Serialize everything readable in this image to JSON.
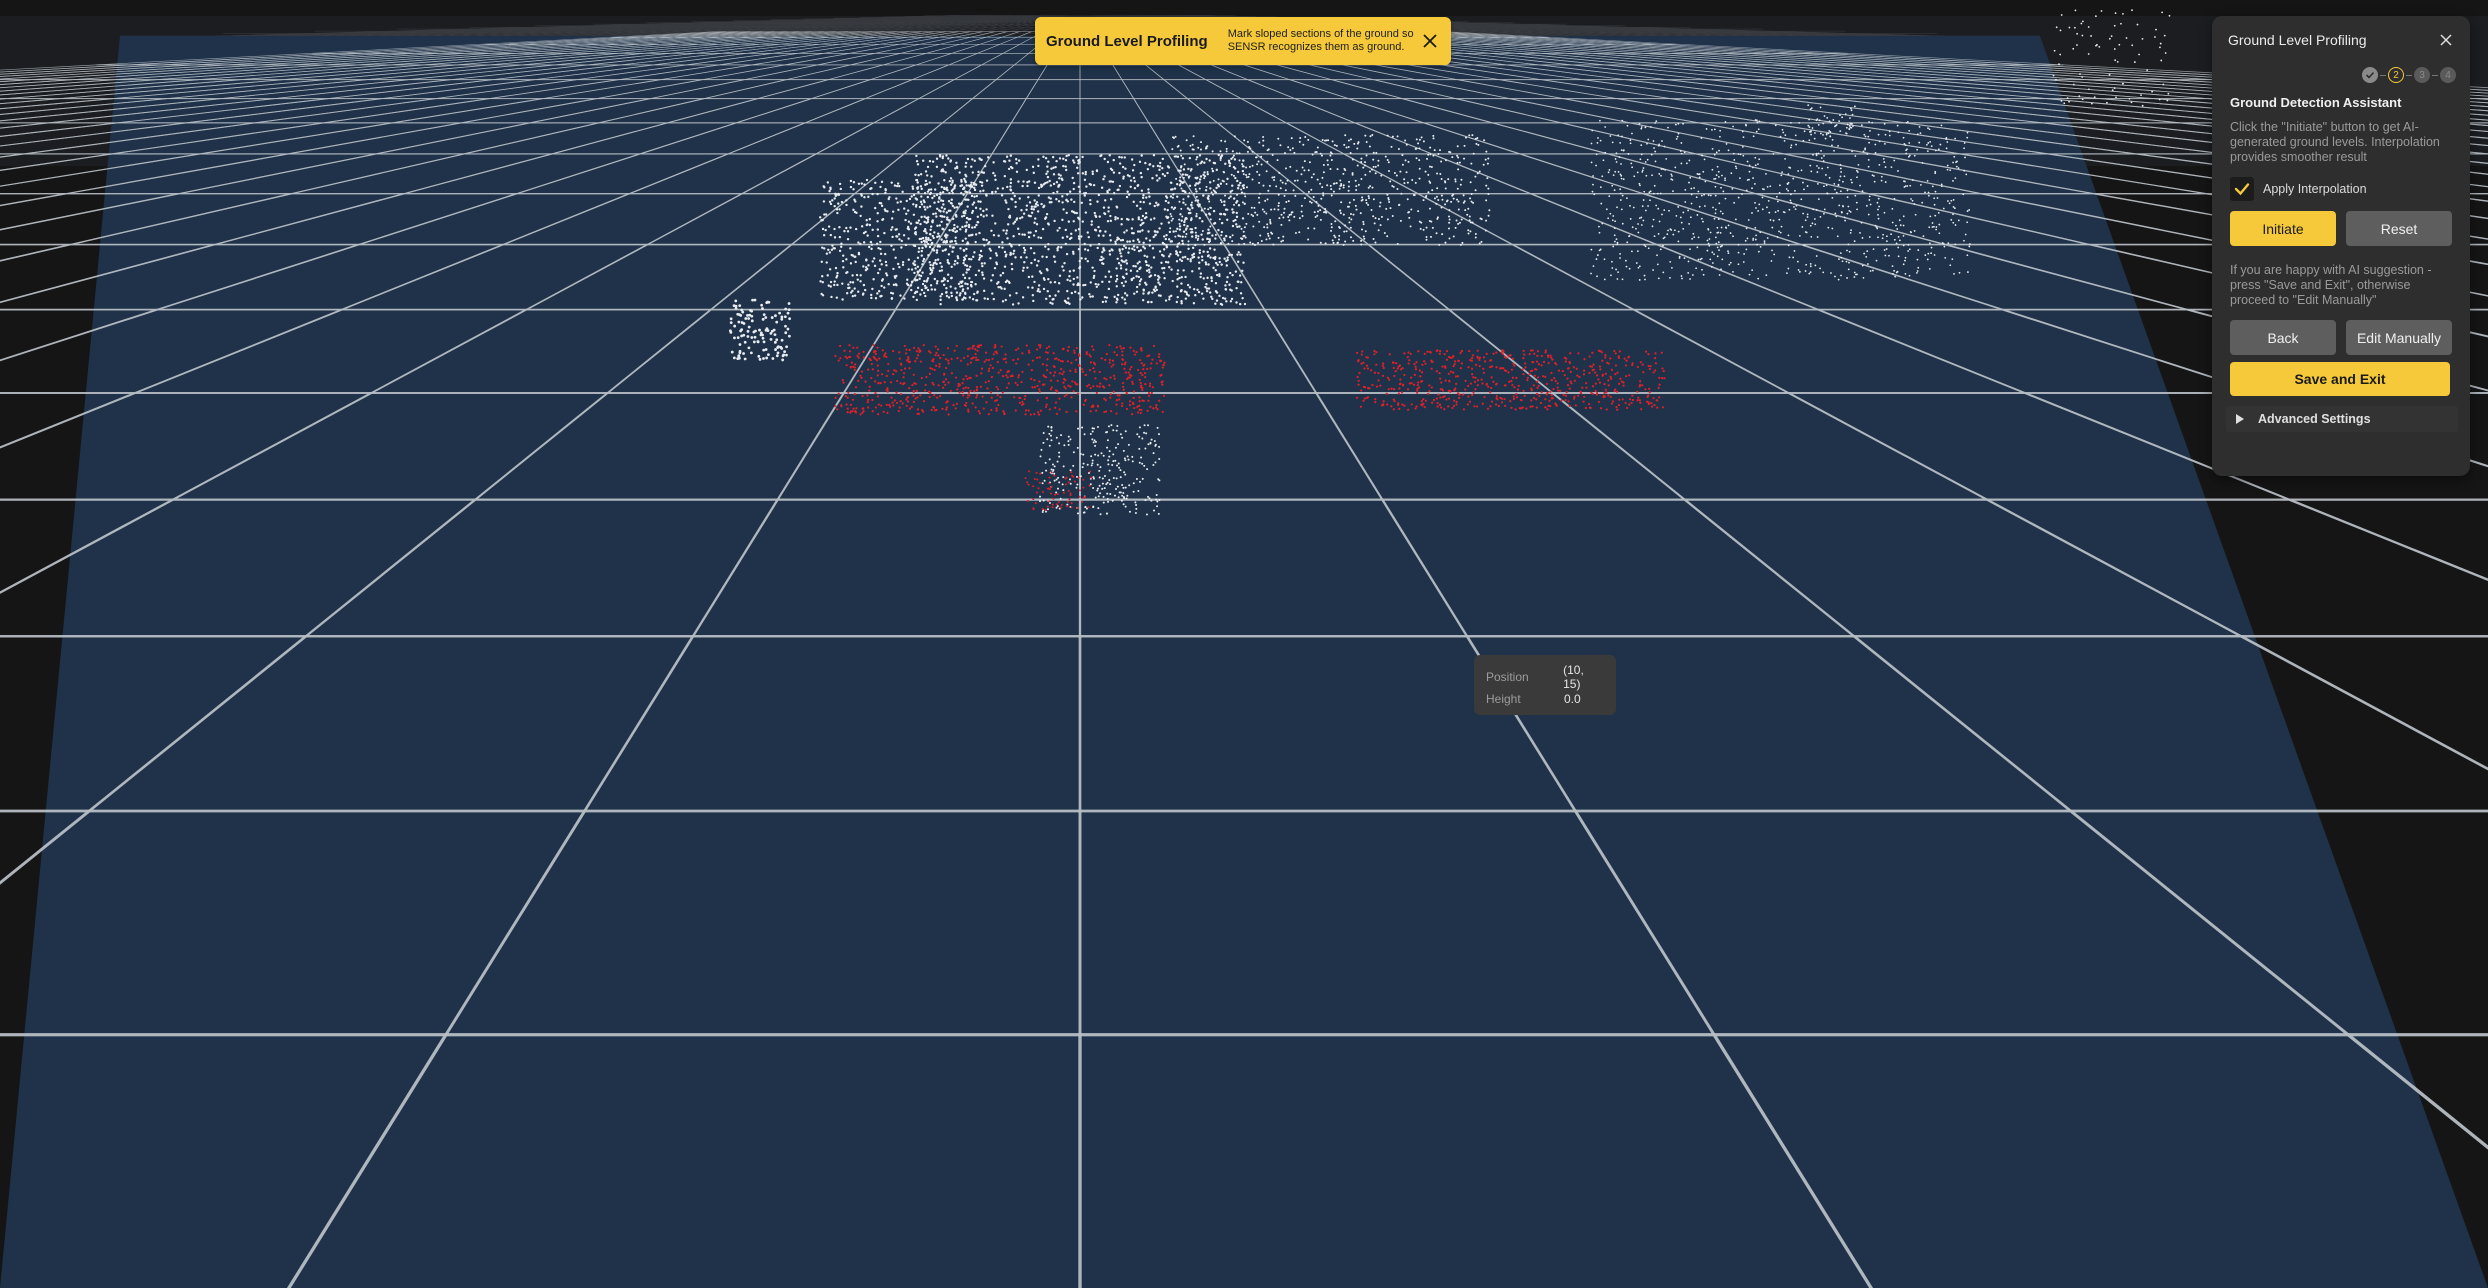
{
  "toast": {
    "title": "Ground Level Profiling",
    "message": "Mark sloped sections of the ground so SENSR recognizes them as ground."
  },
  "panel": {
    "title": "Ground Level Profiling",
    "steps": [
      {
        "label": "",
        "state": "done"
      },
      {
        "label": "2",
        "state": "active"
      },
      {
        "label": "3",
        "state": "todo"
      },
      {
        "label": "4",
        "state": "todo"
      }
    ],
    "section_title": "Ground Detection Assistant",
    "description": "Click the \"Initiate\" button to get AI-generated ground levels. Interpolation provides smoother result",
    "checkbox_label": "Apply Interpolation",
    "checkbox_checked": true,
    "initiate_label": "Initiate",
    "reset_label": "Reset",
    "description2": "If you are happy with AI suggestion - press \"Save and Exit\", otherwise proceed to \"Edit Manually\"",
    "back_label": "Back",
    "edit_manually_label": "Edit Manually",
    "save_exit_label": "Save and Exit",
    "advanced_label": "Advanced Settings"
  },
  "tooltip": {
    "position_label": "Position",
    "position_value": "(10, 15)",
    "height_label": "Height",
    "height_value": "0.0"
  },
  "colors": {
    "accent": "#f5c93a",
    "ground_plane": "#1f3249",
    "grid_line": "#b8bfc6",
    "highlight_points": "#e0202a",
    "points": "#e8ecf0"
  }
}
